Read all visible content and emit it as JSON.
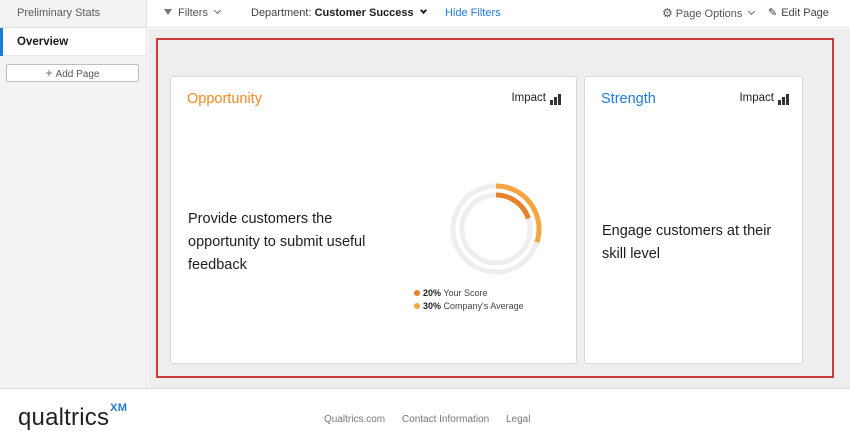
{
  "sidebar": {
    "header": "Preliminary Stats",
    "items": [
      {
        "label": "Overview",
        "active": true
      }
    ],
    "add_page_label": "Add Page"
  },
  "toolbar": {
    "filters_label": "Filters",
    "department_label": "Department:",
    "department_value": "Customer Success",
    "hide_filters_label": "Hide Filters",
    "page_options_label": "Page Options",
    "edit_page_label": "Edit Page"
  },
  "cards": [
    {
      "title": "Opportunity",
      "impact_label": "Impact",
      "description": "Provide customers the opportunity to submit useful feedback",
      "score": {
        "your_score_pct": 20,
        "your_score_label": "Your Score",
        "company_avg_pct": 30,
        "company_avg_label": "Company's Average",
        "your_score_text": "20%",
        "company_avg_text": "30%"
      }
    },
    {
      "title": "Strength",
      "impact_label": "Impact",
      "description": "Engage customers at their skill level"
    }
  ],
  "colors": {
    "accent_blue": "#1e7bd6",
    "opportunity_orange": "#ef8a22",
    "your_score": "#e8822a",
    "company_avg": "#f5a640",
    "highlight_frame": "#cc3b3b"
  },
  "footer": {
    "logo_text": "qualtrics",
    "logo_sup": "XM",
    "links": [
      "Qualtrics.com",
      "Contact Information",
      "Legal"
    ]
  }
}
